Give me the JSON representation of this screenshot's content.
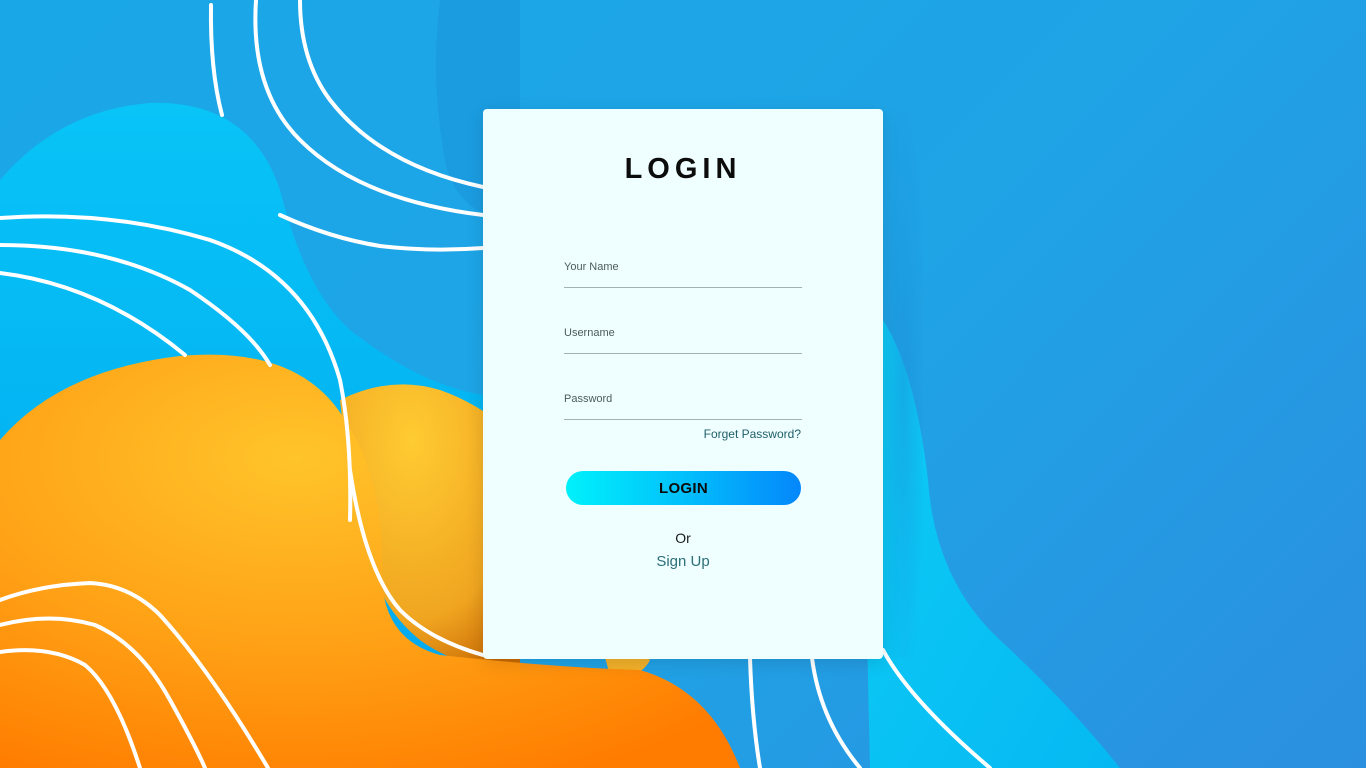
{
  "login_card": {
    "title": "LOGIN",
    "fields": [
      {
        "label": "Your Name"
      },
      {
        "label": "Username"
      },
      {
        "label": "Password"
      }
    ],
    "forgot_password": "Forget Password?",
    "login_button": "LOGIN",
    "or_text": "Or",
    "signup_link": "Sign Up"
  },
  "colors": {
    "background_blue": "#1fa4e6",
    "card_background": "#effefe",
    "button_gradient_start": "#00f1fb",
    "button_gradient_end": "#0487fb",
    "link_color": "#2c6f78",
    "orange_blob": "#ff8a00",
    "yellow_blob": "#ffc02a"
  }
}
